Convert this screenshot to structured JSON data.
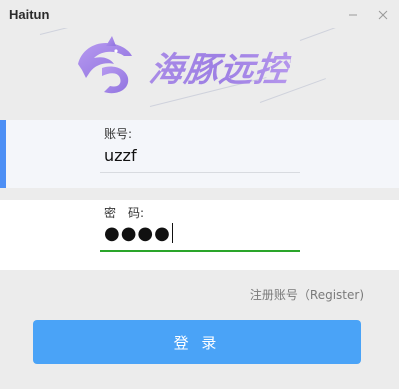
{
  "window": {
    "title": "Haitun",
    "minimize_icon": "minimize-icon",
    "close_icon": "close-icon"
  },
  "banner": {
    "logo_icon": "dolphin-logo-icon",
    "logo_text": "海豚远控",
    "logo_color": "#9f82e5"
  },
  "form": {
    "account": {
      "label": "账号:",
      "value": "uzzf"
    },
    "password": {
      "label": "密　码:",
      "value": "●●●●"
    },
    "register_link": "注册账号（Register)",
    "login_button": "登 录"
  },
  "colors": {
    "accent_blue": "#4d8ff5",
    "button_blue": "#4aa3f7",
    "focus_green": "#2aa52a"
  }
}
